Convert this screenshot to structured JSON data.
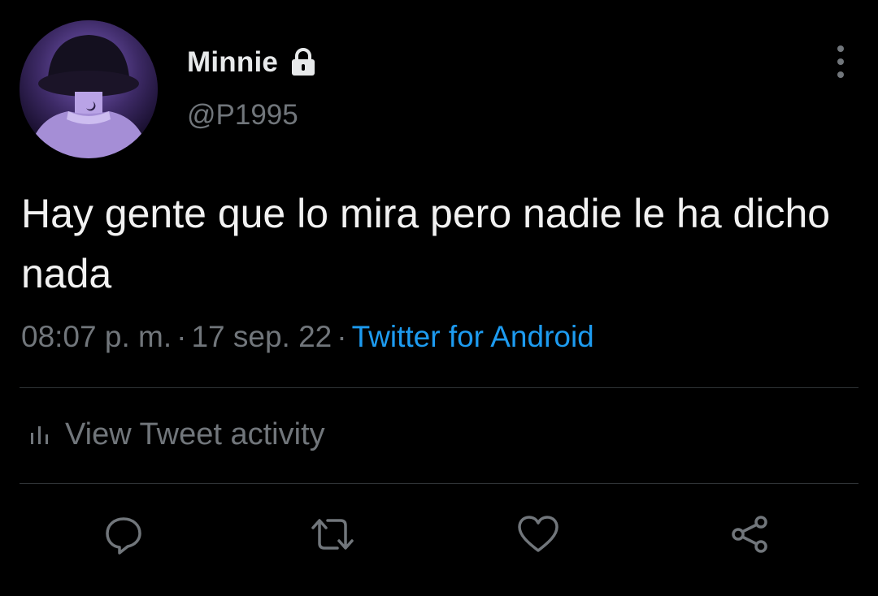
{
  "user": {
    "display_name": "Minnie",
    "handle": "@P1995",
    "protected_icon": "lock-icon",
    "avatar": "profile-avatar"
  },
  "tweet": {
    "text": "Hay gente que lo mira pero nadie le ha dicho nada",
    "time": "08:07 p. m.",
    "separator": "·",
    "date": "17 sep. 22",
    "source": "Twitter for Android"
  },
  "activity": {
    "icon": "analytics-icon",
    "label": "View Tweet activity"
  },
  "actions": {
    "reply_icon": "reply-icon",
    "retweet_icon": "retweet-icon",
    "like_icon": "heart-icon",
    "share_icon": "share-icon"
  },
  "menu_icon": "more-options-icon",
  "colors": {
    "background": "#000000",
    "primary_text": "#e7e9ea",
    "secondary_text": "#71767b",
    "link": "#1d9bf0",
    "divider": "#2f3336"
  }
}
